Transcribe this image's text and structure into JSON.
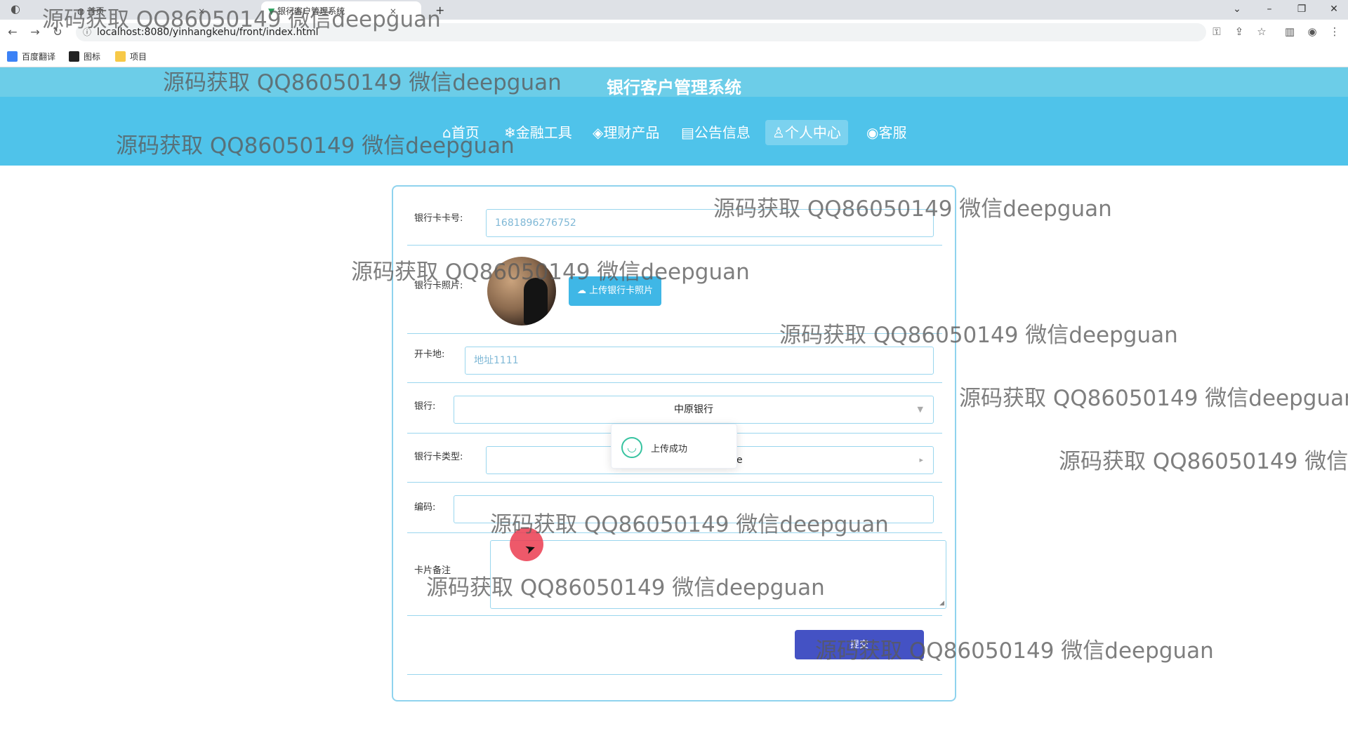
{
  "browser": {
    "tabs": [
      {
        "title": "首页",
        "active": false
      },
      {
        "title": "银行客户管理系统",
        "active": true
      }
    ],
    "url": "localhost:8080/yinhangkehu/front/index.html",
    "bookmarks": [
      "百度翻译",
      "图标",
      "项目"
    ],
    "new_tab_glyph": "+",
    "tab_close_glyph": "×"
  },
  "site": {
    "title": "银行客户管理系统",
    "nav": [
      {
        "label": "⌂首页",
        "icon": "home-icon",
        "active": false
      },
      {
        "label": "❄金融工具",
        "icon": "snowflake-icon",
        "active": false
      },
      {
        "label": "◈理财产品",
        "icon": "layers-icon",
        "active": false
      },
      {
        "label": "▤公告信息",
        "icon": "notice-icon",
        "active": false
      },
      {
        "label": "♙个人中心",
        "icon": "user-icon",
        "active": true
      },
      {
        "label": "◉客服",
        "icon": "support-icon",
        "active": false
      }
    ]
  },
  "form": {
    "card_no_label": "银行卡卡号:",
    "card_no_value": "1681896276752",
    "photo_label": "银行卡照片:",
    "upload_label": "上传银行卡照片",
    "address_label": "开卡地:",
    "address_value": "地址1111",
    "bank_label": "银行:",
    "bank_value": "中原银行",
    "card_type_label": "银行卡类型:",
    "card_type_partial": "e",
    "code_label": "编码:",
    "code_value": "",
    "remark_label": "卡片备注",
    "submit_label": "提交"
  },
  "toast": {
    "message": "上传成功"
  },
  "watermark": "源码获取 QQ86050149 微信deepguan",
  "watermark_clipped": "源码获取 QQ86050149 微信d",
  "colors": {
    "title_bar": "#6ccde8",
    "nav_bar": "#4fc3ea",
    "border": "#9ad6ee",
    "submit": "#4452c4",
    "upload": "#3fb7e6"
  }
}
